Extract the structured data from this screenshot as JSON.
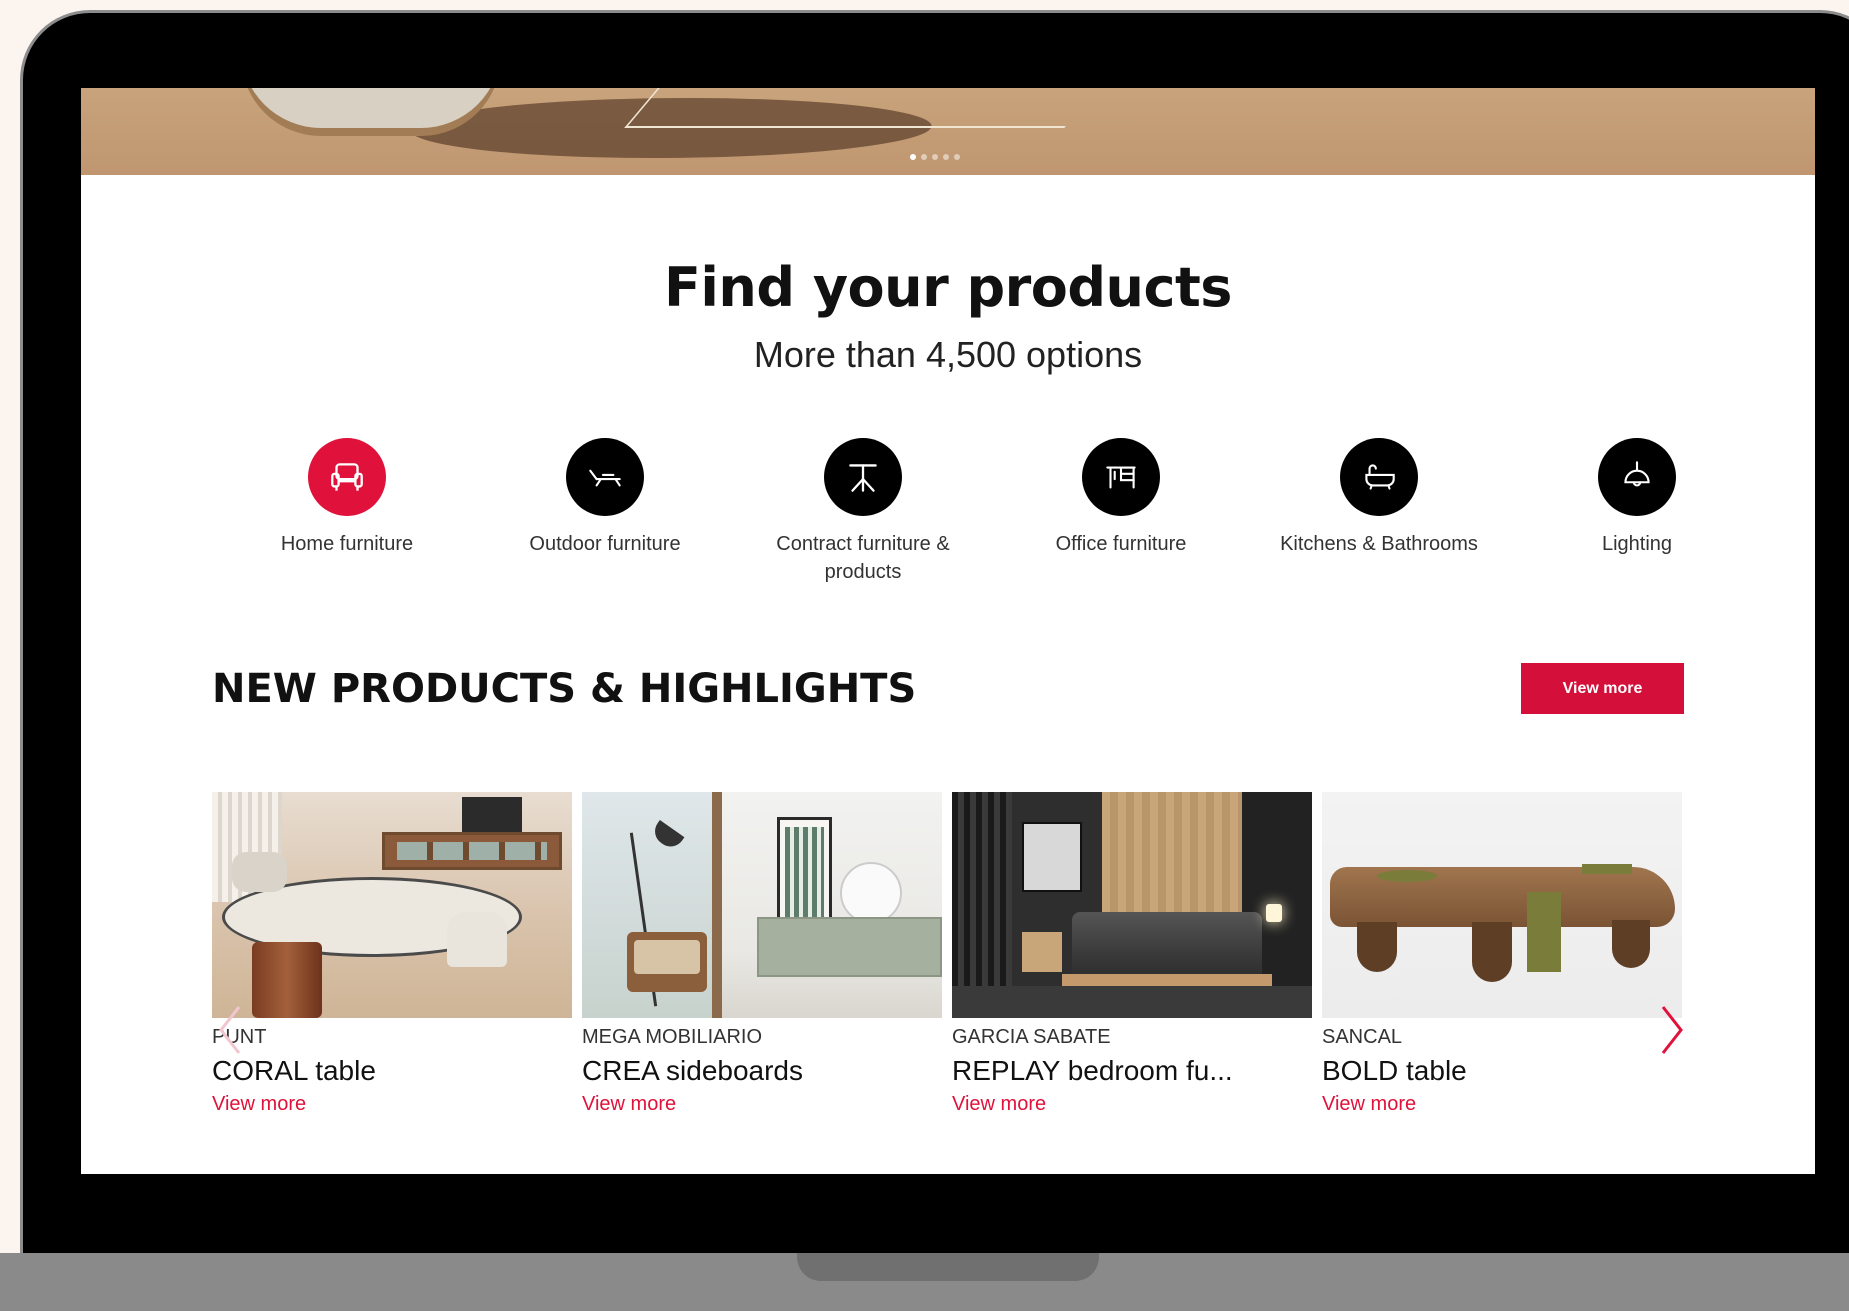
{
  "hero": {
    "dots": 5,
    "active_dot": 0
  },
  "find": {
    "title": "Find your products",
    "subtitle": "More than 4,500 options"
  },
  "categories": [
    {
      "label": "Home furniture",
      "icon": "armchair-icon",
      "active": true
    },
    {
      "label": "Outdoor furniture",
      "icon": "lounger-icon",
      "active": false
    },
    {
      "label": "Contract furniture & products",
      "icon": "table-icon",
      "active": false
    },
    {
      "label": "Office furniture",
      "icon": "desk-icon",
      "active": false
    },
    {
      "label": "Kitchens & Bathrooms",
      "icon": "bathtub-icon",
      "active": false
    },
    {
      "label": "Lighting",
      "icon": "pendant-lamp-icon",
      "active": false
    }
  ],
  "new_products": {
    "title": "NEW PRODUCTS & HIGHLIGHTS",
    "button": "View more",
    "items": [
      {
        "brand": "PUNT",
        "name": "CORAL table",
        "link": "View more"
      },
      {
        "brand": "MEGA MOBILIARIO",
        "name": "CREA sideboards",
        "link": "View more"
      },
      {
        "brand": "GARCIA SABATE",
        "name": "REPLAY bedroom fu...",
        "link": "View more"
      },
      {
        "brand": "SANCAL",
        "name": "BOLD table",
        "link": "View more"
      }
    ]
  },
  "colors": {
    "accent": "#e0113a",
    "icon_bg": "#000000"
  }
}
